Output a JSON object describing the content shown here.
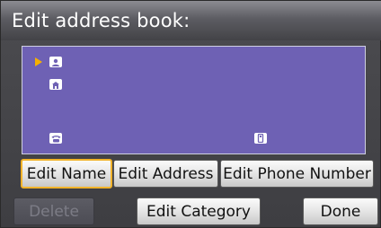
{
  "title": "Edit address book:",
  "entry_icons": [
    "person-icon",
    "home-icon",
    "phone-icon",
    "mobile-icon"
  ],
  "buttons": {
    "edit_name": "Edit Name",
    "edit_address": "Edit Address",
    "edit_phone_number": "Edit Phone Number",
    "delete": "Delete",
    "edit_category": "Edit Category",
    "done": "Done"
  },
  "selected_button": "edit_name",
  "colors": {
    "panel": "#6e61b4",
    "highlight": "#f2b32a"
  }
}
